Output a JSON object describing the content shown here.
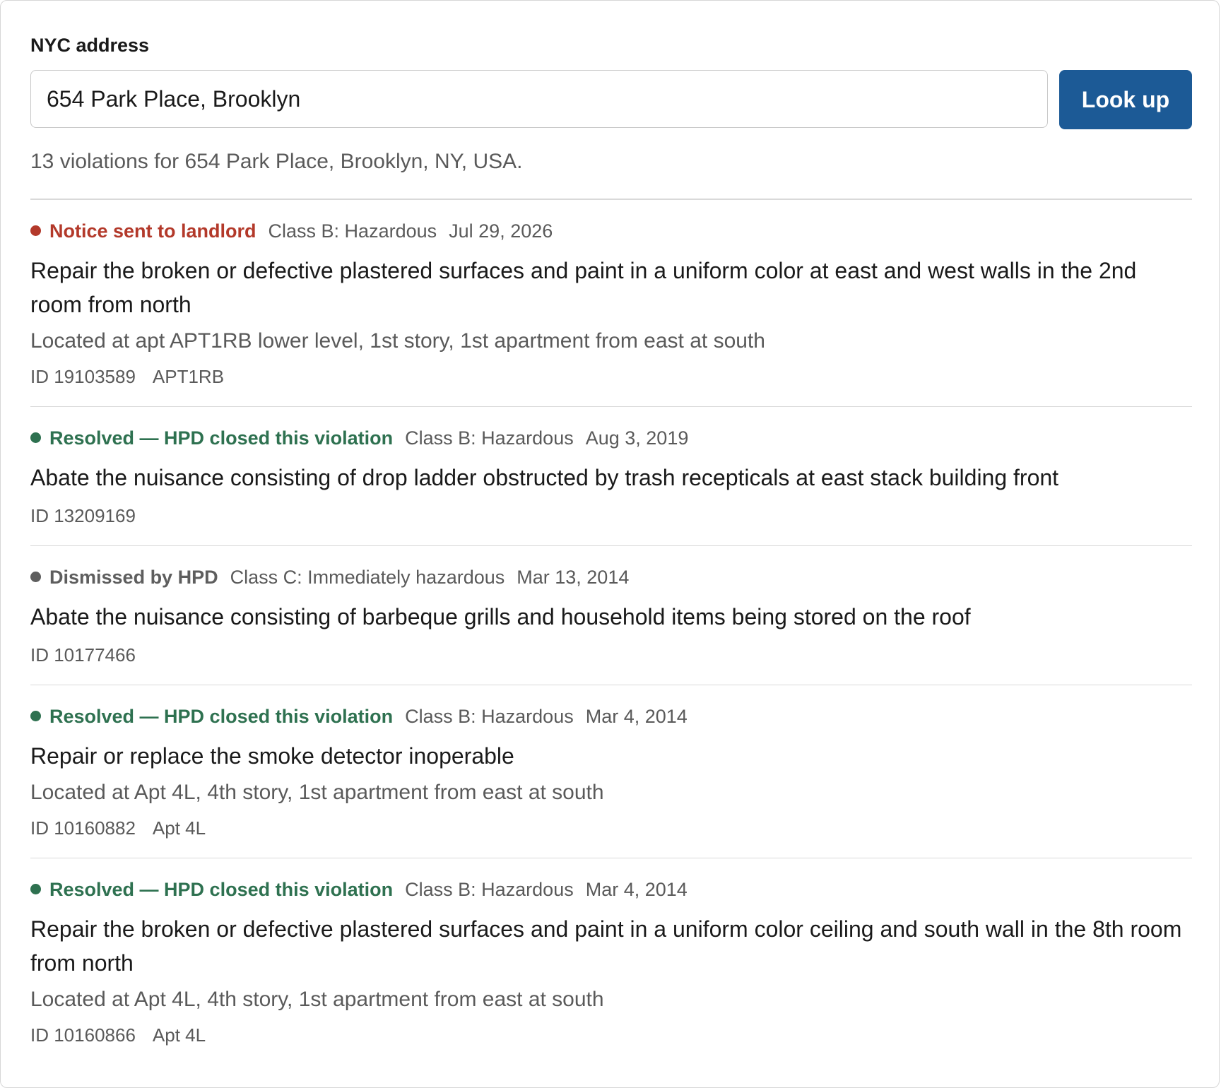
{
  "form": {
    "label": "NYC address",
    "address_value": "654 Park Place, Brooklyn",
    "lookup_label": "Look up"
  },
  "summary": "13 violations for 654 Park Place, Brooklyn, NY, USA.",
  "colors": {
    "open": "#b3392a",
    "resolved": "#2e7150",
    "dismissed": "#5e5e5e",
    "button": "#1c5a96"
  },
  "violations": [
    {
      "status": "Notice sent to landlord",
      "status_kind": "open",
      "class": "Class B: Hazardous",
      "date": "Jul 29, 2026",
      "description": "Repair the broken or defective plastered surfaces and paint in a uniform color at east and west walls in the 2nd room from north",
      "location": "Located at apt APT1RB lower level, 1st story, 1st apartment from east at south",
      "id": "ID 19103589",
      "apt": "APT1RB"
    },
    {
      "status": "Resolved — HPD closed this violation",
      "status_kind": "resolved",
      "class": "Class B: Hazardous",
      "date": "Aug 3, 2019",
      "description": "Abate the nuisance consisting of drop ladder obstructed by trash recepticals at east stack building front",
      "location": "",
      "id": "ID 13209169",
      "apt": ""
    },
    {
      "status": "Dismissed by HPD",
      "status_kind": "dismissed",
      "class": "Class C: Immediately hazardous",
      "date": "Mar 13, 2014",
      "description": "Abate the nuisance consisting of barbeque grills and household items being stored on the roof",
      "location": "",
      "id": "ID 10177466",
      "apt": ""
    },
    {
      "status": "Resolved — HPD closed this violation",
      "status_kind": "resolved",
      "class": "Class B: Hazardous",
      "date": "Mar 4, 2014",
      "description": "Repair or replace the smoke detector inoperable",
      "location": "Located at Apt 4L, 4th story, 1st apartment from east at south",
      "id": "ID 10160882",
      "apt": "Apt 4L"
    },
    {
      "status": "Resolved — HPD closed this violation",
      "status_kind": "resolved",
      "class": "Class B: Hazardous",
      "date": "Mar 4, 2014",
      "description": "Repair the broken or defective plastered surfaces and paint in a uniform color ceiling and south wall in the 8th room from north",
      "location": "Located at Apt 4L, 4th story, 1st apartment from east at south",
      "id": "ID 10160866",
      "apt": "Apt 4L"
    }
  ]
}
